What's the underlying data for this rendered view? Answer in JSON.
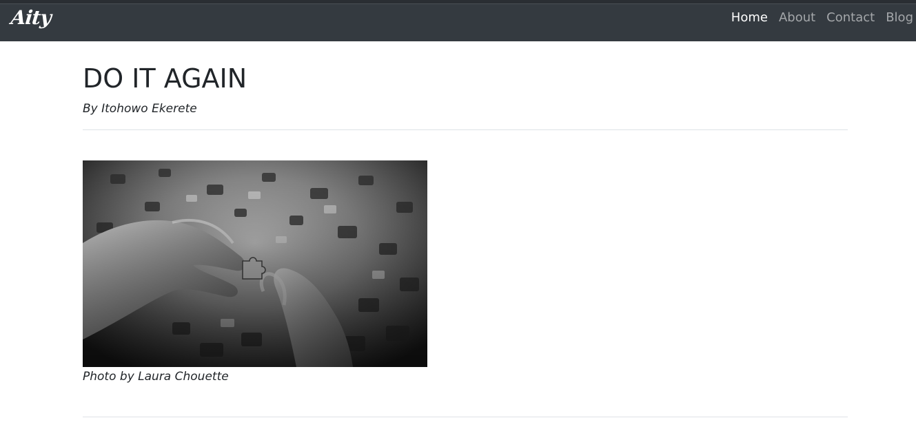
{
  "navbar": {
    "brand": "Aity",
    "links": [
      {
        "label": "Home",
        "active": true
      },
      {
        "label": "About",
        "active": false
      },
      {
        "label": "Contact",
        "active": false
      },
      {
        "label": "Blog",
        "active": false
      }
    ]
  },
  "post": {
    "title": "DO IT AGAIN",
    "byline": "By Itohowo Ekerete",
    "image_alt": "black and white photo of hands holding a jigsaw puzzle piece",
    "caption": "Photo by Laura Chouette"
  },
  "colors": {
    "navbar_bg": "#343a40",
    "text": "#212529",
    "divider": "#dee2e6"
  }
}
